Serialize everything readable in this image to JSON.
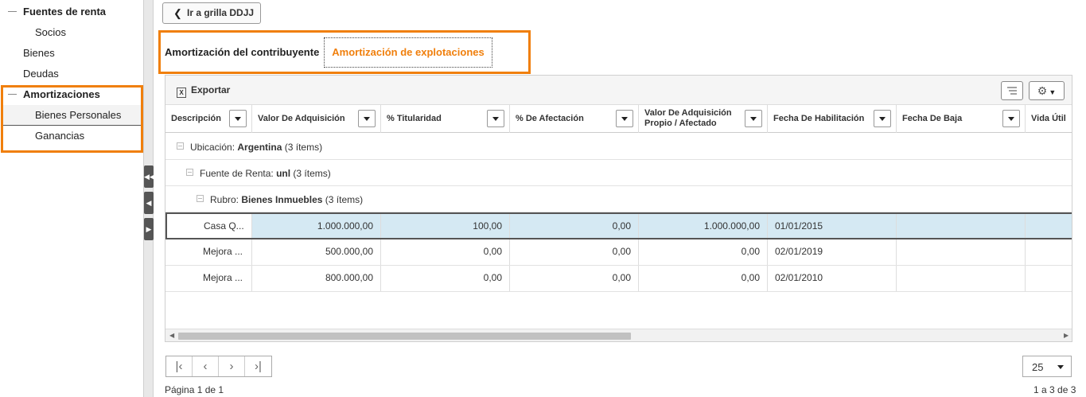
{
  "sidebar": {
    "items": [
      {
        "label": "Fuentes de renta"
      },
      {
        "label": "Socios"
      },
      {
        "label": "Bienes"
      },
      {
        "label": "Deudas"
      },
      {
        "label": "Amortizaciones"
      },
      {
        "label": "Bienes Personales"
      },
      {
        "label": "Ganancias"
      }
    ]
  },
  "back_button": {
    "label": "Ir a grilla DDJJ",
    "icon": "chevron-left-icon"
  },
  "tabs": [
    {
      "label": "Amortización del contribuyente",
      "active": false
    },
    {
      "label": "Amortización de explotaciones",
      "active": true
    }
  ],
  "toolbar": {
    "export_label": "Exportar",
    "icons": [
      "excel-icon",
      "columns-icon",
      "gear-icon"
    ]
  },
  "columns": [
    {
      "label": "Descripción"
    },
    {
      "label": "Valor De Adquisición"
    },
    {
      "label": "% Titularidad"
    },
    {
      "label": "% De Afectación"
    },
    {
      "label": "Valor De Adquisición Propio / Afectado"
    },
    {
      "label": "Fecha De Habilitación"
    },
    {
      "label": "Fecha De Baja"
    },
    {
      "label": "Vida Útil"
    }
  ],
  "groups": {
    "ubicacion": {
      "label": "Ubicación:",
      "value": "Argentina",
      "count": "(3 ítems)"
    },
    "fuente": {
      "label": "Fuente de Renta:",
      "value": "unl",
      "count": "(3 ítems)"
    },
    "rubro": {
      "label": "Rubro:",
      "value": "Bienes Inmuebles",
      "count": "(3 ítems)"
    }
  },
  "rows": [
    {
      "descripcion": "Casa Q...",
      "valor": "1.000.000,00",
      "titularidad": "100,00",
      "afectacion": "0,00",
      "propio": "1.000.000,00",
      "habilitacion": "01/01/2015",
      "baja": "",
      "vida": ""
    },
    {
      "descripcion": "Mejora ...",
      "valor": "500.000,00",
      "titularidad": "0,00",
      "afectacion": "0,00",
      "propio": "0,00",
      "habilitacion": "02/01/2019",
      "baja": "",
      "vida": ""
    },
    {
      "descripcion": "Mejora ...",
      "valor": "800.000,00",
      "titularidad": "0,00",
      "afectacion": "0,00",
      "propio": "0,00",
      "habilitacion": "02/01/2010",
      "baja": "",
      "vida": ""
    }
  ],
  "pager": {
    "page_info": "Página 1 de 1",
    "items_info": "1 a 3 de 3",
    "page_size": "25"
  },
  "colors": {
    "accent": "#f07f0c",
    "selected_row": "#d5e9f3"
  }
}
